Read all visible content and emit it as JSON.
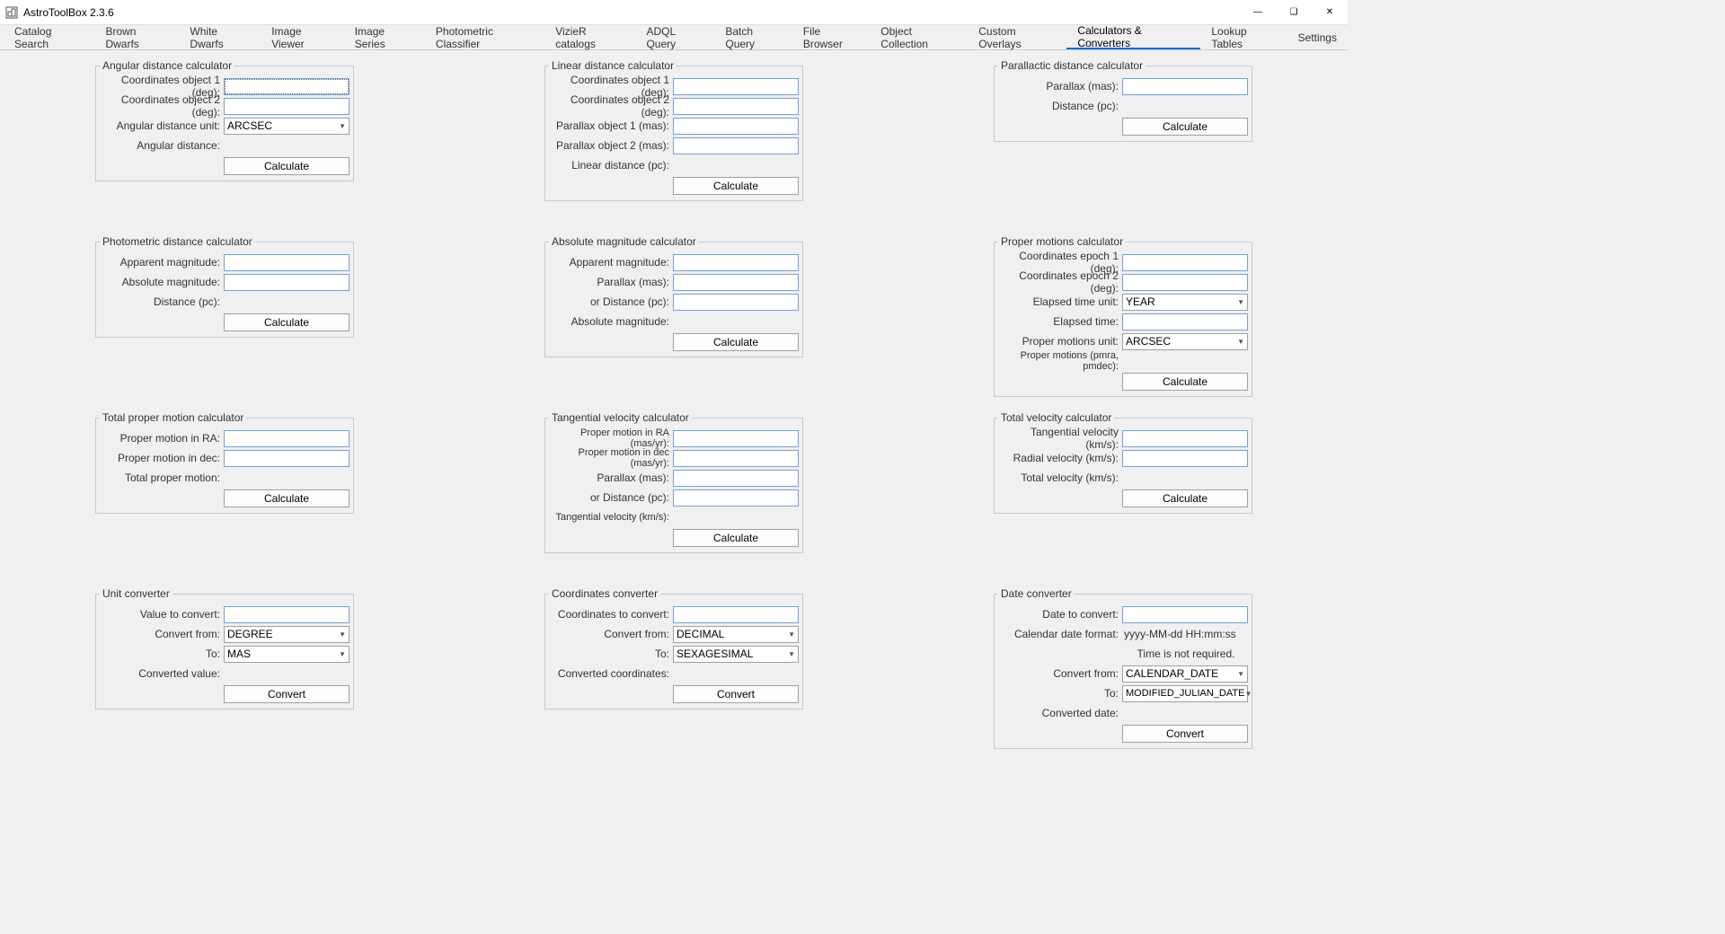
{
  "app": {
    "title": "AstroToolBox 2.3.6"
  },
  "tabs": [
    "Catalog Search",
    "Brown Dwarfs",
    "White Dwarfs",
    "Image Viewer",
    "Image Series",
    "Photometric Classifier",
    "VizieR catalogs",
    "ADQL Query",
    "Batch Query",
    "File Browser",
    "Object Collection",
    "Custom Overlays",
    "Calculators & Converters",
    "Lookup Tables",
    "Settings"
  ],
  "active_tab_index": 12,
  "btn": {
    "calculate": "Calculate",
    "convert": "Convert"
  },
  "panels": {
    "angular": {
      "legend": "Angular distance calculator",
      "coord1": "Coordinates object 1 (deg):",
      "coord2": "Coordinates object 2 (deg):",
      "unit_label": "Angular distance unit:",
      "unit_value": "ARCSEC",
      "result": "Angular distance:"
    },
    "linear": {
      "legend": "Linear distance calculator",
      "coord1": "Coordinates object 1 (deg):",
      "coord2": "Coordinates object 2 (deg):",
      "plx1": "Parallax object 1 (mas):",
      "plx2": "Parallax object 2 (mas):",
      "result": "Linear distance (pc):"
    },
    "parallactic": {
      "legend": "Parallactic distance calculator",
      "plx": "Parallax (mas):",
      "dist": "Distance (pc):"
    },
    "photdist": {
      "legend": "Photometric distance calculator",
      "appmag": "Apparent magnitude:",
      "absmag": "Absolute magnitude:",
      "dist": "Distance (pc):"
    },
    "absmag": {
      "legend": "Absolute magnitude calculator",
      "appmag": "Apparent magnitude:",
      "plx": "Parallax (mas):",
      "or_dist": "or Distance (pc):",
      "result": "Absolute magnitude:"
    },
    "pm": {
      "legend": "Proper motions calculator",
      "coord1": "Coordinates epoch 1 (deg):",
      "coord2": "Coordinates epoch 2 (deg):",
      "etu_label": "Elapsed time unit:",
      "etu_value": "YEAR",
      "et": "Elapsed time:",
      "pmu_label": "Proper motions unit:",
      "pmu_value": "ARCSEC",
      "result": "Proper motions (pmra, pmdec):"
    },
    "totpm": {
      "legend": "Total proper motion calculator",
      "pmra": "Proper motion in RA:",
      "pmdec": "Proper motion in dec:",
      "result": "Total proper motion:"
    },
    "tanvel": {
      "legend": "Tangential velocity calculator",
      "pmra": "Proper motion in RA (mas/yr):",
      "pmdec": "Proper motion in dec (mas/yr):",
      "plx": "Parallax (mas):",
      "or_dist": "or Distance (pc):",
      "result": "Tangential velocity (km/s):"
    },
    "totvel": {
      "legend": "Total velocity calculator",
      "tan": "Tangential velocity (km/s):",
      "rad": "Radial velocity (km/s):",
      "result": "Total velocity (km/s):"
    },
    "unit": {
      "legend": "Unit converter",
      "value": "Value to convert:",
      "from_label": "Convert from:",
      "from_value": "DEGREE",
      "to_label": "To:",
      "to_value": "MAS",
      "result": "Converted value:"
    },
    "coordconv": {
      "legend": "Coordinates converter",
      "coords": "Coordinates to convert:",
      "from_label": "Convert from:",
      "from_value": "DECIMAL",
      "to_label": "To:",
      "to_value": "SEXAGESIMAL",
      "result": "Converted coordinates:"
    },
    "dateconv": {
      "legend": "Date converter",
      "date": "Date to convert:",
      "fmt_label": "Calendar date format:",
      "fmt_value": "yyyy-MM-dd HH:mm:ss",
      "note": "Time is not required.",
      "from_label": "Convert from:",
      "from_value": "CALENDAR_DATE",
      "to_label": "To:",
      "to_value": "MODIFIED_JULIAN_DATE",
      "result": "Converted date:"
    }
  }
}
